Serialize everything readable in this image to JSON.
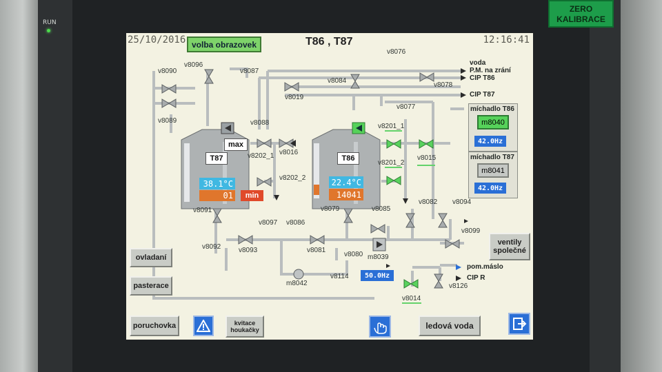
{
  "device": {
    "run_label": "RUN",
    "corner_label": "ZERO\nKALIBRACE"
  },
  "header": {
    "date": "25/10/2016",
    "time": "12:16:41",
    "title": "T86 , T87",
    "nav_button": "volba obrazovek"
  },
  "tanks": [
    {
      "name": "T87",
      "temperature": "38.1°C",
      "level": "01",
      "max_label": "max",
      "min_label": "min"
    },
    {
      "name": "T86",
      "temperature": "22.4°C",
      "level": "14041"
    }
  ],
  "mixers": {
    "t86": {
      "title": "míchadlo T86",
      "id": "m8040",
      "freq": "42.0Hz"
    },
    "t87": {
      "title": "míchadlo T87",
      "id": "m8041",
      "freq": "42.0Hz"
    }
  },
  "pump": {
    "id": "m8039",
    "freq": "50.0Hz"
  },
  "pump2": {
    "id": "m8042"
  },
  "valves": [
    "v8096",
    "v8090",
    "v8089",
    "v8087",
    "v8088",
    "v8019",
    "v8084",
    "v8076",
    "v8078",
    "v8077",
    "v8201_1",
    "v8201_2",
    "v8015",
    "v8202_1",
    "v8202_2",
    "v8016",
    "v8091",
    "v8092",
    "v8093",
    "v8097",
    "v8086",
    "v8081",
    "v8079",
    "v8080",
    "v8085",
    "v8082",
    "v8094",
    "v8099",
    "v8114",
    "v8014",
    "v8126"
  ],
  "destinations": {
    "voda": "voda",
    "pm": "P.M. na zrání",
    "cip_t86": "CIP T86",
    "cip_t87": "CIP T87",
    "pom_maslo": "pom.máslo",
    "cip_r": "CIP R"
  },
  "buttons": {
    "ovladani": "ovladaní",
    "pasterace": "pasterace",
    "ventily": "ventily společné",
    "poruchovka": "poruchovka",
    "kvitace": "kvitace houkačky",
    "ledova": "ledová voda"
  }
}
